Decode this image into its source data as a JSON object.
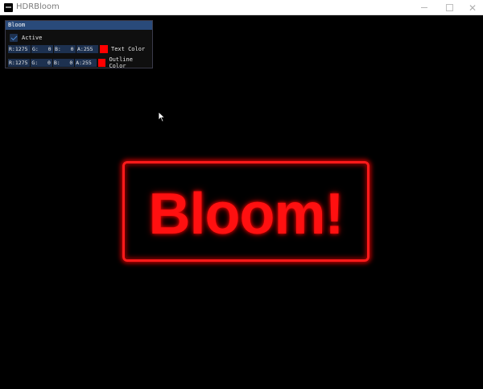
{
  "window": {
    "title": "HDRBloom",
    "icon": "app-icon",
    "controls": [
      "minimize-icon",
      "maximize-icon",
      "close-icon"
    ]
  },
  "panel": {
    "title": "Bloom",
    "active": {
      "label": "Active",
      "checked": true
    },
    "text_color": {
      "label": "Text Color",
      "r": "R:1275",
      "g": "G:   0",
      "b": "B:   0",
      "a": "A:255",
      "swatch": "#ff0000"
    },
    "outline_color": {
      "label": "Outline Color",
      "r": "R:1275",
      "g": "G:   0",
      "b": "B:   0",
      "a": "A:255",
      "swatch": "#ff0000"
    }
  },
  "scene": {
    "text": "Bloom!",
    "glow_color": "#ff0000",
    "background": "#000000"
  }
}
